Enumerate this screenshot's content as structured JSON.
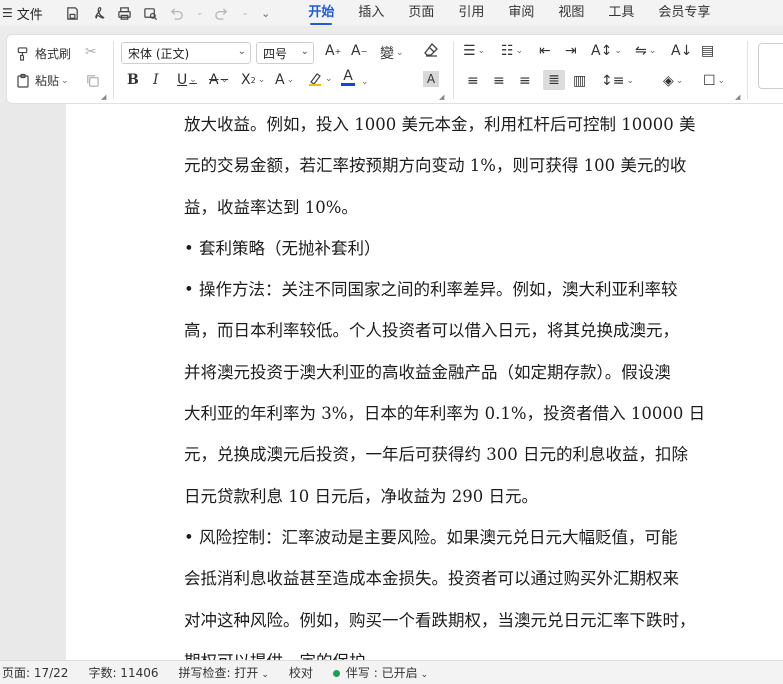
{
  "menubar": {
    "file_label": "文件",
    "tabs": [
      {
        "label": "开始",
        "active": true
      },
      {
        "label": "插入",
        "active": false
      },
      {
        "label": "页面",
        "active": false
      },
      {
        "label": "引用",
        "active": false
      },
      {
        "label": "审阅",
        "active": false
      },
      {
        "label": "视图",
        "active": false
      },
      {
        "label": "工具",
        "active": false
      },
      {
        "label": "会员专享",
        "active": false
      }
    ]
  },
  "ribbon": {
    "format_painter": "格式刷",
    "paste": "粘贴",
    "font_name": "宋体 (正文)",
    "font_size": "四号",
    "accent_color": "#1f5bd9",
    "font_color_bar": "#1f3ed9"
  },
  "document": {
    "paragraphs": [
      {
        "lines": [
          "放大收益。例如，投入 1000 美元本金，利用杠杆后可控制 10000 美",
          "元的交易金额，若汇率按预期方向变动 1%，则可获得 100 美元的收",
          "益，收益率达到 10%。"
        ]
      },
      {
        "lines": [
          "•  套利策略（无抛补套利）"
        ]
      },
      {
        "lines": [
          "•  操作方法：关注不同国家之间的利率差异。例如，澳大利亚利率较",
          "高，而日本利率较低。个人投资者可以借入日元，将其兑换成澳元，",
          "并将澳元投资于澳大利亚的高收益金融产品（如定期存款）。假设澳",
          "大利亚的年利率为 3%，日本的年利率为 0.1%，投资者借入 10000 日",
          "元，兑换成澳元后投资，一年后可获得约 300 日元的利息收益，扣除",
          "日元贷款利息 10 日元后，净收益为 290 日元。"
        ]
      },
      {
        "lines": [
          "•  风险控制：汇率波动是主要风险。如果澳元兑日元大幅贬值，可能",
          "会抵消利息收益甚至造成本金损失。投资者可以通过购买外汇期权来",
          "对冲这种风险。例如，购买一个看跌期权，当澳元兑日元汇率下跌时，",
          "期权可以提供一定的保护。"
        ]
      }
    ]
  },
  "statusbar": {
    "page": "页面: 17/22",
    "word_count": "字数: 11406",
    "spell_check": "拼写检查: 打开",
    "proofread": "校对",
    "companion": "伴写 : 已开启",
    "companion_dot_color": "#19a05b"
  }
}
